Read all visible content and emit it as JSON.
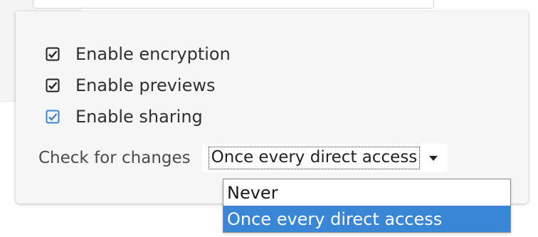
{
  "options": [
    {
      "label": "Enable encryption",
      "checked": true,
      "check_color": "#222222"
    },
    {
      "label": "Enable previews",
      "checked": true,
      "check_color": "#222222"
    },
    {
      "label": "Enable sharing",
      "checked": true,
      "check_color": "#3b82d6"
    }
  ],
  "check_for_changes": {
    "label": "Check for changes",
    "selected_value": "Once every direct access",
    "options": [
      "Never",
      "Once every direct access"
    ],
    "highlighted_index": 1
  },
  "colors": {
    "accent": "#3a86d6",
    "popover_bg": "#f6f6f6"
  }
}
